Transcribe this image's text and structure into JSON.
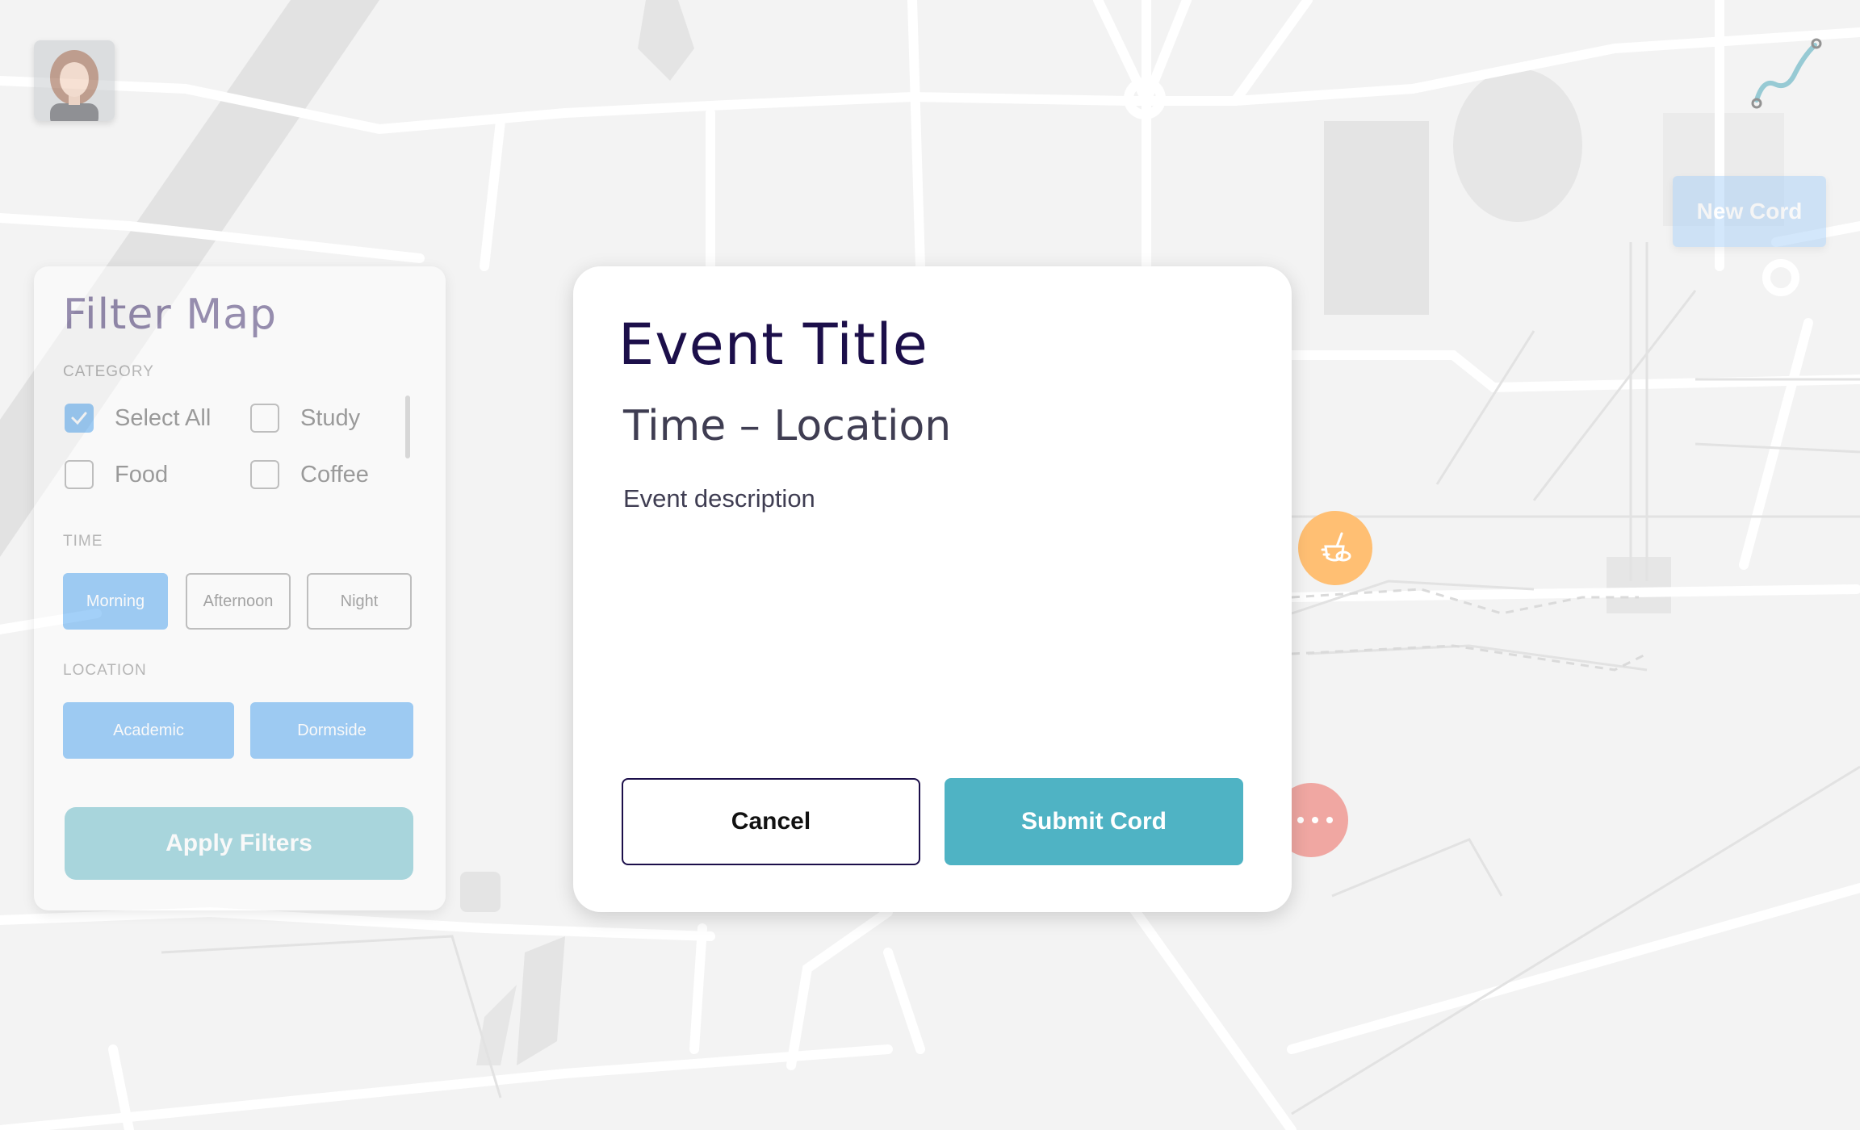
{
  "app": {
    "new_cord_label": "New Cord",
    "colors": {
      "primary": "#4fb3c4",
      "accent_blue": "#4aa3f2",
      "title": "#1c0f4a",
      "food_marker": "#ffbf73",
      "more_marker": "#f0a7a2"
    },
    "icons": [
      "user-avatar",
      "cord-logo-icon",
      "food-marker-icon",
      "more-dots-icon",
      "checkmark-icon"
    ]
  },
  "filter": {
    "title": "Filter Map",
    "category_label": "CATEGORY",
    "categories": [
      {
        "label": "Select All",
        "checked": true
      },
      {
        "label": "Study",
        "checked": false
      },
      {
        "label": "Food",
        "checked": false
      },
      {
        "label": "Coffee",
        "checked": false
      }
    ],
    "time_label": "TIME",
    "time_options": [
      {
        "label": "Morning",
        "selected": true
      },
      {
        "label": "Afternoon",
        "selected": false
      },
      {
        "label": "Night",
        "selected": false
      }
    ],
    "location_label": "LOCATION",
    "location_options": [
      {
        "label": "Academic",
        "selected": true
      },
      {
        "label": "Dormside",
        "selected": true
      }
    ],
    "apply_label": "Apply Filters"
  },
  "modal": {
    "title": "Event Title",
    "subtitle": "Time – Location",
    "description": "Event description",
    "cancel_label": "Cancel",
    "submit_label": "Submit Cord"
  }
}
